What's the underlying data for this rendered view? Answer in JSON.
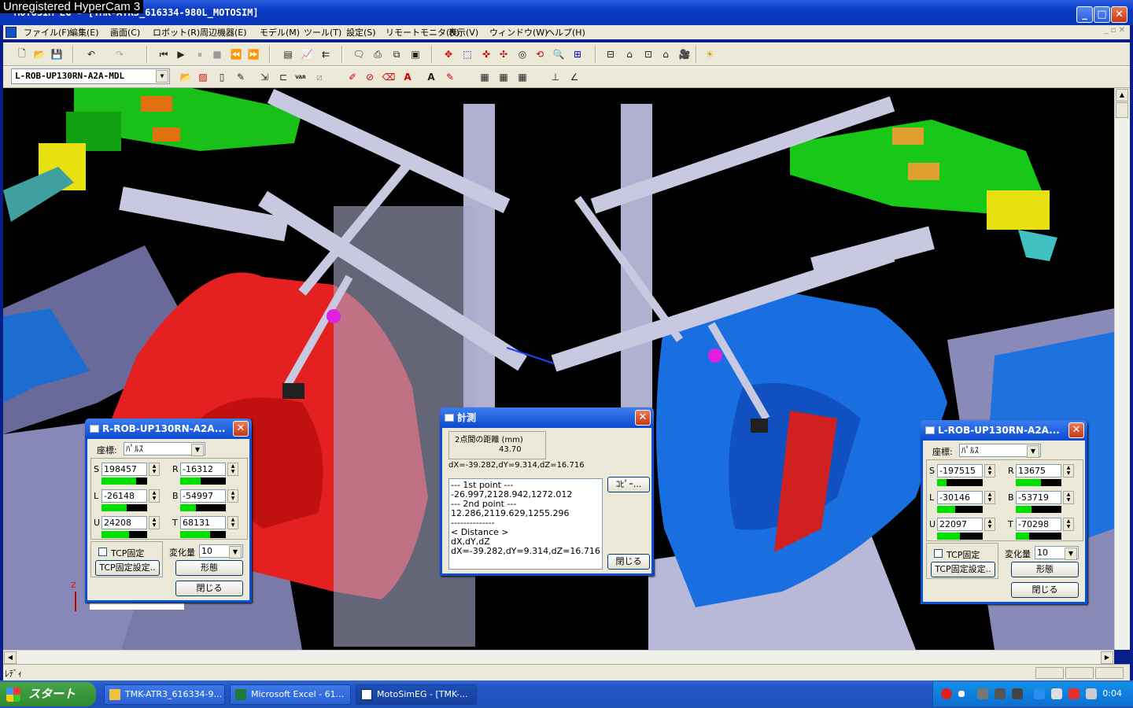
{
  "watermark": "Unregistered HyperCam 3",
  "window": {
    "title": "MOTOSIM EG - [TMK-ATR3_616334-980L_MOTOSIM]",
    "min": "_",
    "max": "□",
    "close": "✕"
  },
  "menu": {
    "items": [
      "ファイル(F)",
      "編集(E)",
      "画面(C)",
      "ロボット(R)",
      "周辺機器(E)",
      "モデル(M)",
      "ツール(T)",
      "設定(S)",
      "リモートモニタ(N)",
      "表示(V)",
      "ウィンドウ(W)",
      "ヘルプ(H)"
    ],
    "mdi": "_ ▫ ✕"
  },
  "toolbar2": {
    "robot_select": "L-ROB-UP130RN-A2A-MDL",
    "var_label": "VAR"
  },
  "status": {
    "text": "ﾚﾃﾞｨ"
  },
  "left_dialog": {
    "title": "R-ROB-UP130RN-A2A...",
    "coord_label": "座標:",
    "coord_value": "ﾊﾟﾙｽ",
    "axes": [
      {
        "name": "S",
        "value": "198457",
        "level": 0.75
      },
      {
        "name": "R",
        "value": "-16312",
        "level": 0.45
      },
      {
        "name": "L",
        "value": "-26148",
        "level": 0.55
      },
      {
        "name": "B",
        "value": "-54997",
        "level": 0.35
      },
      {
        "name": "U",
        "value": "24208",
        "level": 0.6
      },
      {
        "name": "T",
        "value": "68131",
        "level": 0.65
      }
    ],
    "tcp_fix": "TCP固定",
    "tcp_fix_settings": "TCP固定設定..",
    "change_label": "変化量",
    "change_value": "10",
    "shape_btn": "形態",
    "close_btn": "閉じる"
  },
  "right_dialog": {
    "title": "L-ROB-UP130RN-A2A...",
    "coord_label": "座標:",
    "coord_value": "ﾊﾟﾙｽ",
    "axes": [
      {
        "name": "S",
        "value": "-197515",
        "level": 0.2
      },
      {
        "name": "R",
        "value": "13675",
        "level": 0.55
      },
      {
        "name": "L",
        "value": "-30146",
        "level": 0.4
      },
      {
        "name": "B",
        "value": "-53719",
        "level": 0.35
      },
      {
        "name": "U",
        "value": "22097",
        "level": 0.5
      },
      {
        "name": "T",
        "value": "-70298",
        "level": 0.3
      }
    ],
    "tcp_fix": "TCP固定",
    "tcp_fix_settings": "TCP固定設定..",
    "change_label": "変化量",
    "change_value": "10",
    "shape_btn": "形態",
    "close_btn": "閉じる"
  },
  "measure_dialog": {
    "title": "計測",
    "distance_label": "2点間の距離 (mm)",
    "distance_value": "43.70",
    "delta": "dX=-39.282,dY=9.314,dZ=16.716",
    "copy_btn": "ｺﾋﾟｰ...",
    "close_btn": "閉じる",
    "log_lines": [
      "--- 1st point ---",
      "-26.997,2128.942,1272.012",
      "--- 2nd point ---",
      "12.286,2119.629,1255.296",
      "--------------",
      "< Distance >",
      "dX,dY,dZ",
      "dX=-39.282,dY=9.314,dZ=16.716"
    ]
  },
  "axis_indicator": {
    "z": "Z"
  },
  "taskbar": {
    "start": "スタート",
    "tasks": [
      "TMK-ATR3_616334-9...",
      "Microsoft Excel - 61...",
      "MotoSimEG - [TMK-..."
    ],
    "clock": "0:04"
  },
  "colors": {
    "accent": "#0a4fd8",
    "part_red": "#e32020",
    "part_blue": "#1a70e0",
    "fixture": "#b4b4d8",
    "taskbar": "#2457c8"
  }
}
